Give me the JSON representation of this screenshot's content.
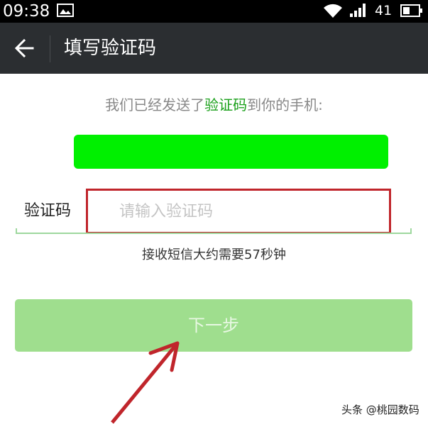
{
  "status_bar": {
    "time": "09:38",
    "battery": "41",
    "icons": [
      "image-icon",
      "wifi-icon",
      "signal-icon",
      "battery-icon"
    ]
  },
  "header": {
    "title": "填写验证码",
    "back_icon": "back-arrow-icon"
  },
  "main": {
    "intro_prefix": "我们已经发送了",
    "intro_highlight": "验证码",
    "intro_suffix": "到你的手机:",
    "code_label": "验证码",
    "code_placeholder": "请输入验证码",
    "code_value": "",
    "countdown_text": "接收短信大约需要57秒钟",
    "next_button": "下一步"
  },
  "annotation": {
    "arrow_icon": "red-arrow-icon"
  },
  "watermark": "头条 @桃园数码",
  "colors": {
    "title_bar": "#2b2e31",
    "highlight": "#1aa01a",
    "phone_redaction": "#00f000",
    "button": "#9fde8e",
    "annotation_red": "#c0252b"
  }
}
